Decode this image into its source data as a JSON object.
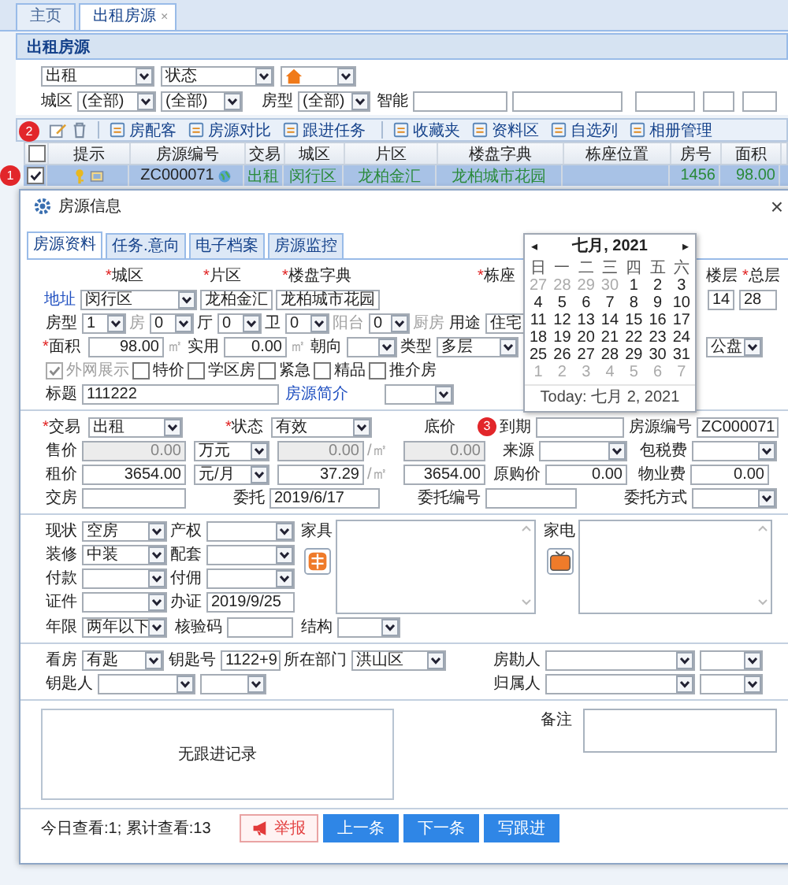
{
  "tabs": [
    {
      "label": "主页",
      "selected": false
    },
    {
      "label": "出租房源",
      "selected": true,
      "close": "×"
    }
  ],
  "panel_title": "出租房源",
  "filters": [
    [
      {
        "kind": "select",
        "value": "出租"
      },
      {
        "kind": "select",
        "value": "状态"
      },
      {
        "kind": "icon_select"
      }
    ],
    [
      {
        "kind": "label",
        "text": "城区"
      },
      {
        "kind": "select",
        "value": "(全部)"
      },
      {
        "kind": "select",
        "value": "(全部)"
      },
      {
        "kind": "label",
        "text": "房型"
      },
      {
        "kind": "select",
        "value": "(全部)"
      },
      {
        "kind": "label",
        "text": "智能"
      },
      {
        "kind": "input"
      },
      {
        "kind": "input"
      },
      {
        "kind": "input"
      },
      {
        "kind": "input"
      },
      {
        "kind": "input"
      }
    ]
  ],
  "toolbar": {
    "badge": "2",
    "groups": [
      [
        "房配客",
        "房源对比",
        "跟进任务"
      ],
      [
        "收藏夹",
        "资料区",
        "自选列",
        "相册管理"
      ]
    ]
  },
  "table": {
    "all_checked": false,
    "columns": [
      "提示",
      "房源编号",
      "交易",
      "城区",
      "片区",
      "楼盘字典",
      "栋座位置",
      "房号",
      "面积"
    ],
    "rows": [
      {
        "badge": "1",
        "checked": true,
        "selected": true,
        "code": "ZC000071",
        "trade": "出租",
        "district": "闵行区",
        "area": "龙柏金汇",
        "estate": "龙柏城市花园",
        "unit": "1456",
        "size": "98.00"
      }
    ]
  },
  "dialog": {
    "title": "房源信息",
    "close": "×",
    "tabs": [
      {
        "label": "房源资料",
        "selected": true
      },
      {
        "label": "任务.意向",
        "selected": false
      },
      {
        "label": "电子档案",
        "selected": false
      },
      {
        "label": "房源监控",
        "selected": false
      }
    ],
    "location": [
      [
        {
          "kind": "label",
          "mark": "*",
          "text": "城区"
        },
        {
          "kind": "label",
          "mark": "*",
          "text": "片区"
        },
        {
          "kind": "label",
          "mark": "*",
          "text": "楼盘字典"
        },
        {
          "kind": "label",
          "mark": "*",
          "text": "栋座"
        },
        {
          "kind": "label",
          "text": "楼层"
        },
        {
          "kind": "label",
          "mark": "*",
          "text": "总层"
        }
      ],
      [
        {
          "kind": "link",
          "text": "地址"
        },
        {
          "kind": "select",
          "value": "闵行区"
        },
        {
          "kind": "input",
          "value": "龙柏金汇"
        },
        {
          "kind": "input",
          "value": "龙柏城市花园"
        },
        {
          "kind": "input",
          "value": "14"
        },
        {
          "kind": "input",
          "value": "28"
        }
      ],
      [
        {
          "kind": "label",
          "text": "房型"
        },
        {
          "kind": "select",
          "value": "1"
        },
        {
          "kind": "label",
          "text": "房",
          "disabled": true
        },
        {
          "kind": "select",
          "value": "0"
        },
        {
          "kind": "label",
          "text": "厅",
          "disabled": false
        },
        {
          "kind": "select",
          "value": "0"
        },
        {
          "kind": "label",
          "text": "卫",
          "disabled": false
        },
        {
          "kind": "select",
          "value": "0"
        },
        {
          "kind": "label",
          "text": "阳台",
          "disabled": true
        },
        {
          "kind": "select",
          "value": "0"
        },
        {
          "kind": "label",
          "text": "厨房",
          "disabled": true
        },
        {
          "kind": "label",
          "text": "用途"
        },
        {
          "kind": "input",
          "value": "住宅"
        }
      ],
      [
        {
          "kind": "label",
          "mark": "*",
          "text": "面积"
        },
        {
          "kind": "num",
          "value": "98.00"
        },
        {
          "kind": "label",
          "text": "㎡",
          "disabled": true
        },
        {
          "kind": "label",
          "text": "实用"
        },
        {
          "kind": "num",
          "value": "0.00"
        },
        {
          "kind": "label",
          "text": "㎡",
          "disabled": true
        },
        {
          "kind": "label",
          "text": "朝向"
        },
        {
          "kind": "select"
        },
        {
          "kind": "label",
          "text": "类型"
        },
        {
          "kind": "select",
          "value": "多层"
        },
        {
          "kind": "select",
          "value": "公盘"
        }
      ],
      [
        {
          "kind": "check",
          "text": "外网展示",
          "checked": true,
          "disabled": true
        },
        {
          "kind": "check",
          "text": "特价",
          "checked": false,
          "disabled": false
        },
        {
          "kind": "check",
          "text": "学区房",
          "checked": false,
          "disabled": false
        },
        {
          "kind": "check",
          "text": "紧急",
          "checked": false,
          "disabled": false
        },
        {
          "kind": "check",
          "text": "精品",
          "checked": false,
          "disabled": false
        },
        {
          "kind": "check",
          "text": "推介房",
          "checked": false,
          "disabled": false
        }
      ],
      [
        {
          "kind": "label",
          "text": "标题"
        },
        {
          "kind": "input",
          "value": "111222"
        },
        {
          "kind": "link",
          "text": "房源简介"
        },
        {
          "kind": "select"
        }
      ]
    ],
    "trade": [
      [
        {
          "kind": "label",
          "mark": "*",
          "text": "交易"
        },
        {
          "kind": "select",
          "value": "出租"
        },
        {
          "kind": "label",
          "mark": "*",
          "text": "状态"
        },
        {
          "kind": "select",
          "value": "有效"
        },
        {
          "kind": "label",
          "text": "底价"
        },
        {
          "kind": "badge",
          "text": "3"
        },
        {
          "kind": "label",
          "text": "到期"
        },
        {
          "kind": "input"
        },
        {
          "kind": "label",
          "text": "房源编号"
        },
        {
          "kind": "input",
          "value": "ZC000071"
        }
      ],
      [
        {
          "kind": "label",
          "text": "售价"
        },
        {
          "kind": "num",
          "value": "0.00",
          "disabled": true
        },
        {
          "kind": "select",
          "value": "万元"
        },
        {
          "kind": "num",
          "value": "0.00",
          "disabled": true
        },
        {
          "kind": "label",
          "text": "/㎡",
          "disabled": true
        },
        {
          "kind": "num",
          "value": "0.00",
          "disabled": true
        },
        {
          "kind": "label",
          "text": "来源"
        },
        {
          "kind": "select"
        },
        {
          "kind": "label",
          "text": "包税费"
        },
        {
          "kind": "select"
        }
      ],
      [
        {
          "kind": "label",
          "text": "租价"
        },
        {
          "kind": "num",
          "value": "3654.00",
          "disabled": false
        },
        {
          "kind": "select",
          "value": "元/月"
        },
        {
          "kind": "num",
          "value": "37.29",
          "disabled": false
        },
        {
          "kind": "label",
          "text": "/㎡",
          "disabled": true
        },
        {
          "kind": "num",
          "value": "3654.00",
          "disabled": false
        },
        {
          "kind": "label",
          "text": "原购价"
        },
        {
          "kind": "num",
          "value": "0.00"
        },
        {
          "kind": "label",
          "text": "物业费"
        },
        {
          "kind": "num",
          "value": "0.00"
        }
      ],
      [
        {
          "kind": "label",
          "text": "交房"
        },
        {
          "kind": "input"
        },
        {
          "kind": "label",
          "text": "委托"
        },
        {
          "kind": "input",
          "value": "2019/6/17"
        },
        {
          "kind": "label",
          "text": "委托编号"
        },
        {
          "kind": "input"
        },
        {
          "kind": "label",
          "text": "委托方式"
        },
        {
          "kind": "select"
        }
      ]
    ],
    "condition": {
      "rows": [
        [
          {
            "kind": "label",
            "text": "现状"
          },
          {
            "kind": "select",
            "value": "空房"
          },
          {
            "kind": "label",
            "text": "产权"
          },
          {
            "kind": "select"
          }
        ],
        [
          {
            "kind": "label",
            "text": "装修"
          },
          {
            "kind": "select",
            "value": "中装"
          },
          {
            "kind": "label",
            "text": "配套"
          },
          {
            "kind": "select"
          }
        ],
        [
          {
            "kind": "label",
            "text": "付款"
          },
          {
            "kind": "select"
          },
          {
            "kind": "label",
            "text": "付佣"
          },
          {
            "kind": "select"
          }
        ],
        [
          {
            "kind": "label",
            "text": "证件"
          },
          {
            "kind": "select"
          },
          {
            "kind": "label",
            "text": "办证"
          },
          {
            "kind": "input",
            "value": "2019/9/25"
          }
        ]
      ],
      "last_row": [
        {
          "kind": "label",
          "text": "年限"
        },
        {
          "kind": "select",
          "value": "两年以下"
        },
        {
          "kind": "label",
          "text": "核验码"
        },
        {
          "kind": "input"
        },
        {
          "kind": "label",
          "text": "结构"
        },
        {
          "kind": "select"
        }
      ],
      "furniture": "家具",
      "appliance": "家电"
    },
    "keys": [
      [
        {
          "kind": "label",
          "text": "看房"
        },
        {
          "kind": "select",
          "value": "有匙"
        },
        {
          "kind": "label",
          "text": "钥匙号"
        },
        {
          "kind": "input",
          "value": "1122+9"
        },
        {
          "kind": "label",
          "text": "所在部门"
        },
        {
          "kind": "select",
          "value": "洪山区"
        },
        {
          "kind": "label",
          "text": "房勘人"
        },
        {
          "kind": "select"
        },
        {
          "kind": "select"
        }
      ],
      [
        {
          "kind": "label",
          "text": "钥匙人"
        },
        {
          "kind": "select"
        },
        {
          "kind": "select"
        },
        {
          "kind": "label",
          "text": "归属人"
        },
        {
          "kind": "select"
        },
        {
          "kind": "select"
        }
      ]
    ],
    "followup": {
      "empty_text": "无跟进记录",
      "remark": "备注"
    },
    "footer": {
      "stats": "今日查看:1; 累计查看:13",
      "buttons": [
        {
          "label": "举报",
          "kind": "report"
        },
        {
          "label": "上一条",
          "kind": "primary"
        },
        {
          "label": "下一条",
          "kind": "primary"
        },
        {
          "label": "写跟进",
          "kind": "primary"
        }
      ]
    }
  },
  "calendar": {
    "prev": "◂",
    "next": "▸",
    "title": "七月, 2021",
    "weekdays": [
      "日",
      "一",
      "二",
      "三",
      "四",
      "五",
      "六"
    ],
    "weeks": [
      [
        {
          "day": "27",
          "outside": true
        },
        {
          "day": "28",
          "outside": true
        },
        {
          "day": "29",
          "outside": true
        },
        {
          "day": "30",
          "outside": true
        },
        {
          "day": "1",
          "outside": false
        },
        {
          "day": "2",
          "outside": false
        },
        {
          "day": "3",
          "outside": false
        }
      ],
      [
        {
          "day": "4",
          "outside": false
        },
        {
          "day": "5",
          "outside": false
        },
        {
          "day": "6",
          "outside": false
        },
        {
          "day": "7",
          "outside": false
        },
        {
          "day": "8",
          "outside": false
        },
        {
          "day": "9",
          "outside": false
        },
        {
          "day": "10",
          "outside": false
        }
      ],
      [
        {
          "day": "11",
          "outside": false
        },
        {
          "day": "12",
          "outside": false
        },
        {
          "day": "13",
          "outside": false
        },
        {
          "day": "14",
          "outside": false
        },
        {
          "day": "15",
          "outside": false
        },
        {
          "day": "16",
          "outside": false
        },
        {
          "day": "17",
          "outside": false
        }
      ],
      [
        {
          "day": "18",
          "outside": false
        },
        {
          "day": "19",
          "outside": false
        },
        {
          "day": "20",
          "outside": false
        },
        {
          "day": "21",
          "outside": false
        },
        {
          "day": "22",
          "outside": false
        },
        {
          "day": "23",
          "outside": false
        },
        {
          "day": "24",
          "outside": false
        }
      ],
      [
        {
          "day": "25",
          "outside": false
        },
        {
          "day": "26",
          "outside": false
        },
        {
          "day": "27",
          "outside": false
        },
        {
          "day": "28",
          "outside": false
        },
        {
          "day": "29",
          "outside": false
        },
        {
          "day": "30",
          "outside": false
        },
        {
          "day": "31",
          "outside": false
        }
      ],
      [
        {
          "day": "1",
          "outside": true
        },
        {
          "day": "2",
          "outside": true
        },
        {
          "day": "3",
          "outside": true
        },
        {
          "day": "4",
          "outside": true
        },
        {
          "day": "5",
          "outside": true
        },
        {
          "day": "6",
          "outside": true
        },
        {
          "day": "7",
          "outside": true
        }
      ]
    ],
    "today": "Today: 七月 2, 2021"
  }
}
